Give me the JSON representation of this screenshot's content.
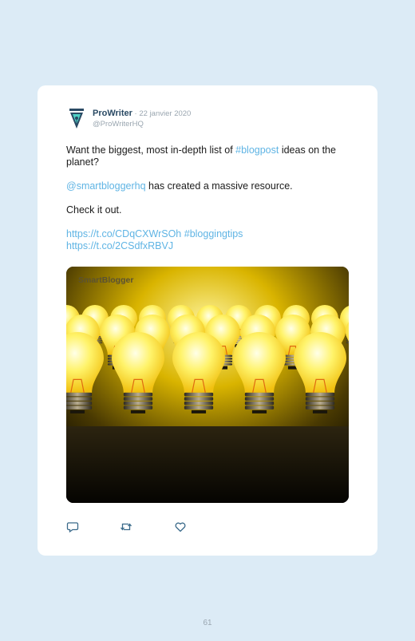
{
  "tweet": {
    "author_name": "ProWriter",
    "date": " · 22 janvier 2020",
    "handle": "@ProWriterHQ",
    "text_1a": "Want the biggest, most in-depth list of ",
    "hashtag_blogpost": "#blogpost",
    "text_1b": " ideas on the planet?",
    "mention": "@smartbloggerhq",
    "text_2": " has created a massive resource.",
    "text_3": "Check it out.",
    "link_1": "https://t.co/CDqCXWrSOh",
    "hashtag_bloggingtips": "#bloggingtips",
    "link_2": "https://t.co/2CSdfxRBVJ",
    "image_watermark": "SmartBlogger",
    "actions": {
      "reply_icon": "reply-icon",
      "retweet_icon": "retweet-icon",
      "like_icon": "heart-icon"
    }
  },
  "page_number": "61",
  "colors": {
    "background": "#dcebf6",
    "card": "#ffffff",
    "link": "#5fb4e4",
    "author": "#2a4a64"
  }
}
